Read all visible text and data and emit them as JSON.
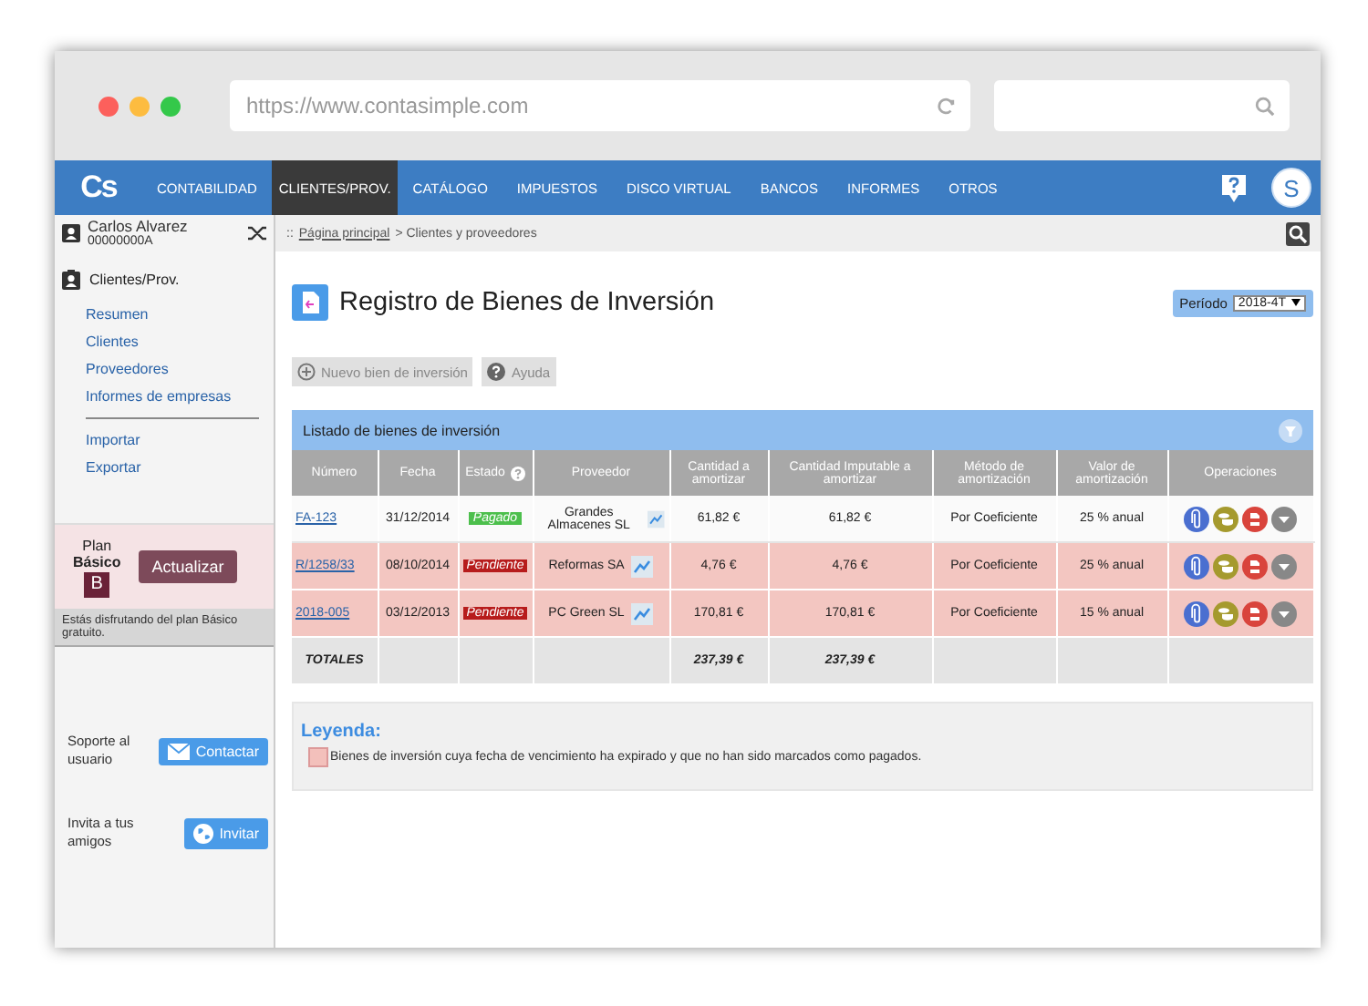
{
  "browser": {
    "url": "https://www.contasimple.com"
  },
  "nav": {
    "logo": "Cs",
    "avatar": "S",
    "items": [
      {
        "label": "CONTABILIDAD",
        "selected": false
      },
      {
        "label": "CLIENTES/PROV.",
        "selected": true
      },
      {
        "label": "CATÁLOGO",
        "selected": false
      },
      {
        "label": "IMPUESTOS",
        "selected": false
      },
      {
        "label": "DISCO VIRTUAL",
        "selected": false
      },
      {
        "label": "BANCOS",
        "selected": false
      },
      {
        "label": "INFORMES",
        "selected": false
      },
      {
        "label": "OTROS",
        "selected": false
      }
    ]
  },
  "user": {
    "name": "Carlos Alvarez",
    "id": "00000000A"
  },
  "breadcrumb": {
    "prefix": "::",
    "link": "Página principal",
    "rest": "> Clientes y proveedores"
  },
  "sidebar": {
    "section": "Clientes/Prov.",
    "groups": [
      [
        "Resumen",
        "Clientes",
        "Proveedores",
        "Informes de empresas"
      ],
      [
        "Importar",
        "Exportar"
      ]
    ]
  },
  "plan": {
    "label": "Plan",
    "name": "Básico",
    "badge": "B",
    "button": "Actualizar",
    "note": "Estás disfrutando del plan Básico gratuito."
  },
  "support": [
    {
      "text": "Soporte al usuario",
      "button": "Contactar",
      "kind": "mail"
    },
    {
      "text": "Invita a tus amigos",
      "button": "Invitar",
      "kind": "globe"
    }
  ],
  "page": {
    "title": "Registro de Bienes de Inversión",
    "period_label": "Período",
    "period": "2018-4T"
  },
  "toolbar": [
    {
      "label": "Nuevo bien de inversión",
      "kind": "add"
    },
    {
      "label": "Ayuda",
      "kind": "help"
    }
  ],
  "panel": {
    "title": "Listado de bienes de inversión"
  },
  "table": {
    "columns": [
      {
        "label": "Número",
        "help": false
      },
      {
        "label": "Fecha",
        "help": false
      },
      {
        "label": "Estado",
        "help": true
      },
      {
        "label": "Proveedor",
        "help": false
      },
      {
        "label": "Cantidad a amortizar",
        "help": false
      },
      {
        "label": "Cantidad Imputable a amortizar",
        "help": false
      },
      {
        "label": "Método de amortización",
        "help": false
      },
      {
        "label": "Valor de amortización",
        "help": false
      },
      {
        "label": "Operaciones",
        "help": false
      }
    ],
    "rows": [
      {
        "number": "FA-123",
        "date": "31/12/2014",
        "status": "Pagado",
        "kind": "paid",
        "supplier": "Grandes Almacenes SL",
        "amount": "61,82 €",
        "imputable": "61,82 €",
        "method": "Por Coeficiente",
        "rate": "25 % anual",
        "expired": false
      },
      {
        "number": "R/1258/33",
        "date": "08/10/2014",
        "status": "Pendiente",
        "kind": "pending",
        "supplier": "Reformas SA",
        "amount": "4,76 €",
        "imputable": "4,76 €",
        "method": "Por Coeficiente",
        "rate": "25 % anual",
        "expired": true
      },
      {
        "number": "2018-005",
        "date": "03/12/2013",
        "status": "Pendiente",
        "kind": "pending",
        "supplier": "PC Green SL",
        "amount": "170,81 €",
        "imputable": "170,81 €",
        "method": "Por Coeficiente",
        "rate": "15 % anual",
        "expired": true
      }
    ],
    "totals": {
      "label": "TOTALES",
      "amount": "237,39 €",
      "imputable": "237,39 €"
    }
  },
  "legend": {
    "title": "Leyenda:",
    "text": "Bienes de inversión cuya fecha de vencimiento ha expirado y que no han sido marcados como pagados."
  }
}
